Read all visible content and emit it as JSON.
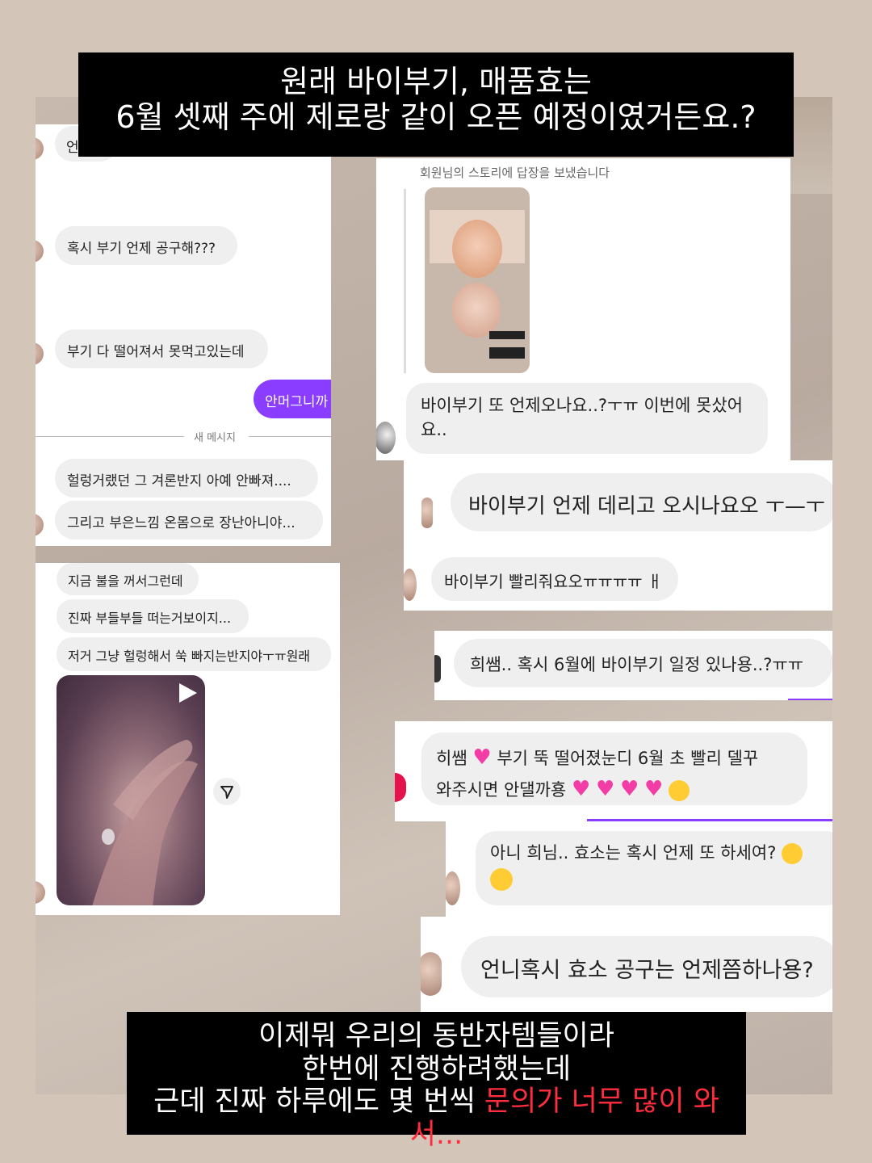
{
  "header_caption": {
    "line1": "원래 바이부기, 매품효는",
    "line2": "6월 셋째 주에 제로랑 같이 오픈 예정이였거든요.?"
  },
  "left_card_1": {
    "partial_text": "언",
    "messages": [
      "혹시 부기 언제 공구해???",
      "부기 다 떨어져서 못먹고있는데"
    ],
    "sent_message": "안머그니까",
    "new_message_divider": "새 메시지",
    "messages_after": [
      "헐렁거랬던 그 겨론반지 아예 안빠져....",
      "그리고 부은느낌 온몸으로 장난아니야..."
    ]
  },
  "left_card_2": {
    "messages": [
      "지금 불을 꺼서그런데",
      "진짜 부들부들 떠는거보이지...",
      "저거 그냥 헐렁해서 쑥 빠지는반지야ㅜㅠ원래"
    ],
    "video_icon": "play-icon",
    "share_icon": "send-icon"
  },
  "right_card_1": {
    "story_reply_label": "회원님의 스토리에 답장을 보냈습니다",
    "message": "바이부기 또 언제오나요..?ㅜㅠ 이번에 못샀어요.."
  },
  "right_card_2": {
    "message": "바이부기 언제 데리고 오시나요오 ㅜ—ㅜ"
  },
  "right_card_3": {
    "message": "바이부기 빨리줘요오ㅠㅠㅠㅠ ㅐ"
  },
  "right_card_4": {
    "message": "희쌤.. 혹시 6월에 바이부기 일정 있나용..?ㅠㅠ"
  },
  "right_card_5": {
    "line1_a": "히쌤",
    "line1_b": "부기 뚝 떨어졌눈디 6월 초 빨리 델꾸",
    "line2": "와주시면 안댈까횽",
    "hearts_color": "#f23ca6"
  },
  "right_card_6": {
    "line1": "아니 희님.. 효소는 혹시 언제 또 하세여?"
  },
  "right_card_7": {
    "message": "언니혹시 효소 공구는 언제쯤하나용?"
  },
  "footer_caption": {
    "line1": "이제뭐 우리의 동반자템들이라",
    "line2": "한번에 진행하려했는데",
    "line3_white": "근데 진짜 하루에도 몇 번씩 ",
    "line3_red": "문의가 너무 많이 와서..."
  },
  "colors": {
    "accent_purple": "#8b3dff",
    "caption_red": "#ff2d3d"
  }
}
